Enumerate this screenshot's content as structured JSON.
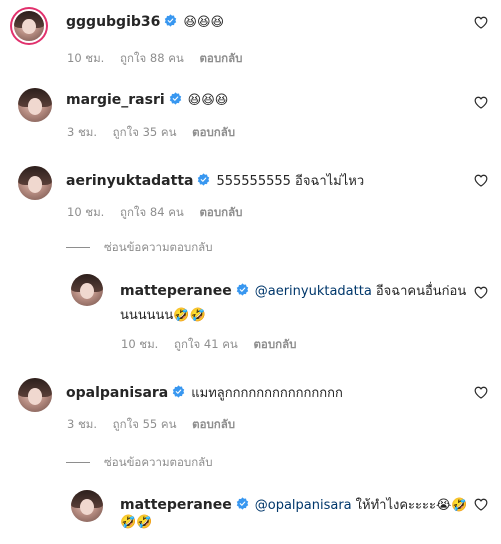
{
  "comments": [
    {
      "username": "gggubgib36",
      "text": "😆😆😆",
      "time": "10 ชม.",
      "likes": "ถูกใจ 88 คน",
      "reply": "ตอบกลับ"
    },
    {
      "username": "margie_rasri",
      "text": "😆😆😆",
      "time": "3 ชม.",
      "likes": "ถูกใจ 35 คน",
      "reply": "ตอบกลับ"
    },
    {
      "username": "aerinyuktadatta",
      "text": "555555555 อีจฉาไม่ไหว",
      "time": "10 ชม.",
      "likes": "ถูกใจ 84 คน",
      "reply": "ตอบกลับ",
      "hide_replies": "ซ่อนข้อความตอบกลับ",
      "reply_item": {
        "username": "matteperanee",
        "mention": "@aerinyuktadatta",
        "text": "อีจฉาคนอื่นก่อน",
        "text2": "นนนนนน🤣🤣",
        "time": "10 ชม.",
        "likes": "ถูกใจ 41 คน",
        "reply": "ตอบกลับ"
      }
    },
    {
      "username": "opalpanisara",
      "text": "แมทลูกกกกกกกกกกกกกกก",
      "time": "3 ชม.",
      "likes": "ถูกใจ 55 คน",
      "reply": "ตอบกลับ",
      "hide_replies": "ซ่อนข้อความตอบกลับ",
      "reply_item": {
        "username": "matteperanee",
        "mention": "@opalpanisara",
        "text": "ให้ทำไงคะะะะ😭🤣",
        "text2": "🤣🤣"
      }
    }
  ],
  "colors": {
    "verified": "#3897f0",
    "mention": "#00376b",
    "meta": "#8e8e8e"
  },
  "icons": [
    "verified-badge-icon",
    "heart-icon"
  ]
}
